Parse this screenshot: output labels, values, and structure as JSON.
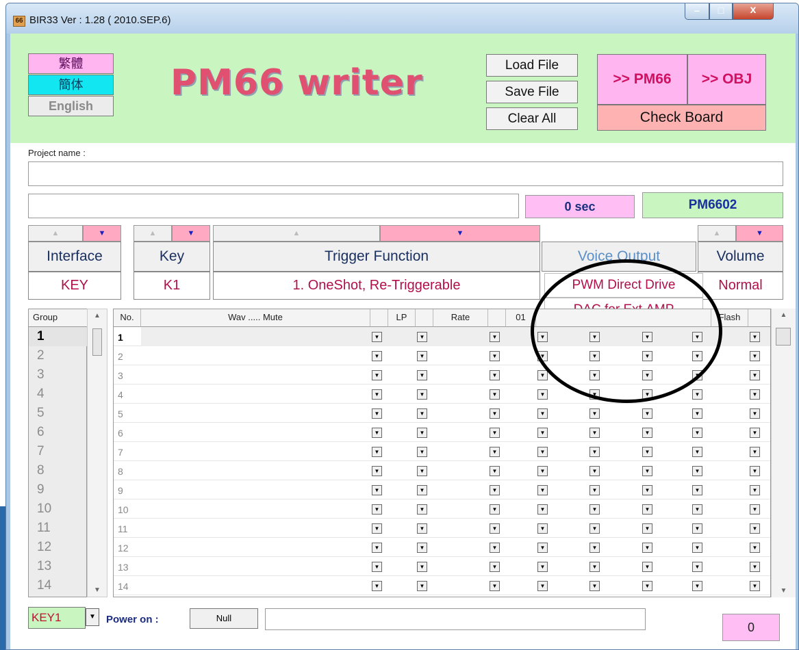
{
  "window": {
    "title": "BIR33 Ver : 1.28 ( 2010.SEP.6)",
    "icon_text": "66",
    "controls": {
      "minimize": "–",
      "maximize": "□",
      "close": "x"
    }
  },
  "header": {
    "lang_traditional": "繁體",
    "lang_simplified": "簡体",
    "lang_english": "English",
    "app_title": "PM66 writer",
    "load_file": "Load File",
    "save_file": "Save File",
    "clear_all": "Clear All",
    "to_pm66": ">> PM66",
    "to_obj": ">> OBJ",
    "check_board": "Check Board"
  },
  "project": {
    "label": "Project name :",
    "name_value": "",
    "status_value": "",
    "duration": "0 sec",
    "chip": "PM6602"
  },
  "config": {
    "up_arrow": "▲",
    "down_arrow": "▼",
    "headers": [
      "Interface",
      "Key",
      "Trigger Function",
      "Voice Output",
      "Volume"
    ],
    "values": [
      "KEY",
      "K1",
      "1. OneShot, Re-Triggerable",
      "PWM Direct Drive",
      "Normal"
    ],
    "voice_output_options": [
      "PWM Direct Drive",
      "DAC for Ext.AMP"
    ]
  },
  "group_list": {
    "header": "Group",
    "items": [
      "1",
      "2",
      "3",
      "4",
      "5",
      "6",
      "7",
      "8",
      "9",
      "10",
      "11",
      "12",
      "13",
      "14"
    ],
    "scroll_up": "▲",
    "scroll_down": "▼"
  },
  "grid": {
    "headers": {
      "no": "No.",
      "wav": "Wav ..... Mute",
      "lp": "LP",
      "rate": "Rate",
      "col01": "01",
      "flash": "Flash"
    },
    "rows": [
      "1",
      "2",
      "3",
      "4",
      "5",
      "6",
      "7",
      "8",
      "9",
      "10",
      "11",
      "12",
      "13",
      "14"
    ],
    "dropdown_glyph": "▼"
  },
  "bottom": {
    "key_select": "KEY1",
    "power_on_label": "Power on :",
    "null_button": "Null",
    "zero_value": "0"
  }
}
